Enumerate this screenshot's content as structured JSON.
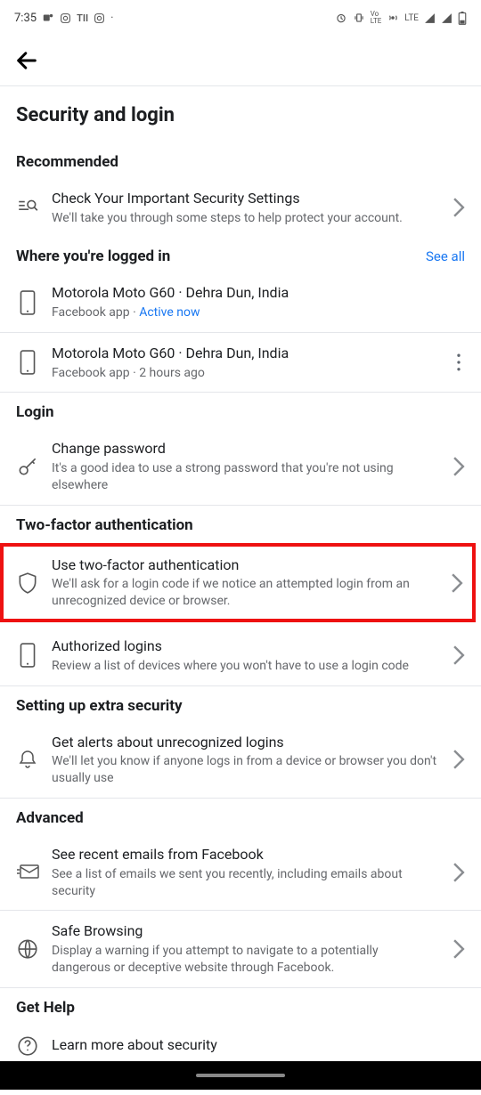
{
  "statusBar": {
    "time": "7:35",
    "lte": "LTE"
  },
  "pageTitle": "Security and login",
  "sections": {
    "recommended": {
      "header": "Recommended",
      "item": {
        "title": "Check Your Important Security Settings",
        "sub": "We'll take you through some steps to help protect your account."
      }
    },
    "loggedIn": {
      "header": "Where you're logged in",
      "seeAll": "See all",
      "devices": [
        {
          "title": "Motorola Moto G60 · Dehra Dun, India",
          "app": "Facebook app",
          "status": "Active now"
        },
        {
          "title": "Motorola Moto G60 · Dehra Dun, India",
          "app": "Facebook app",
          "status": "2 hours ago"
        }
      ]
    },
    "login": {
      "header": "Login",
      "changePassword": {
        "title": "Change password",
        "sub": "It's a good idea to use a strong password that you're not using elsewhere"
      }
    },
    "twoFactor": {
      "header": "Two-factor authentication",
      "use2fa": {
        "title": "Use two-factor authentication",
        "sub": "We'll ask for a login code if we notice an attempted login from an unrecognized device or browser."
      },
      "authorized": {
        "title": "Authorized logins",
        "sub": "Review a list of devices where you won't have to use a login code"
      }
    },
    "extraSecurity": {
      "header": "Setting up extra security",
      "alerts": {
        "title": "Get alerts about unrecognized logins",
        "sub": "We'll let you know if anyone logs in from a device or browser you don't usually use"
      }
    },
    "advanced": {
      "header": "Advanced",
      "emails": {
        "title": "See recent emails from Facebook",
        "sub": "See a list of emails we sent you recently, including emails about security"
      },
      "safeBrowsing": {
        "title": "Safe Browsing",
        "sub": "Display a warning if you attempt to navigate to a potentially dangerous or deceptive website through Facebook."
      }
    },
    "getHelp": {
      "header": "Get Help",
      "learnMore": {
        "title": "Learn more about security"
      }
    }
  }
}
